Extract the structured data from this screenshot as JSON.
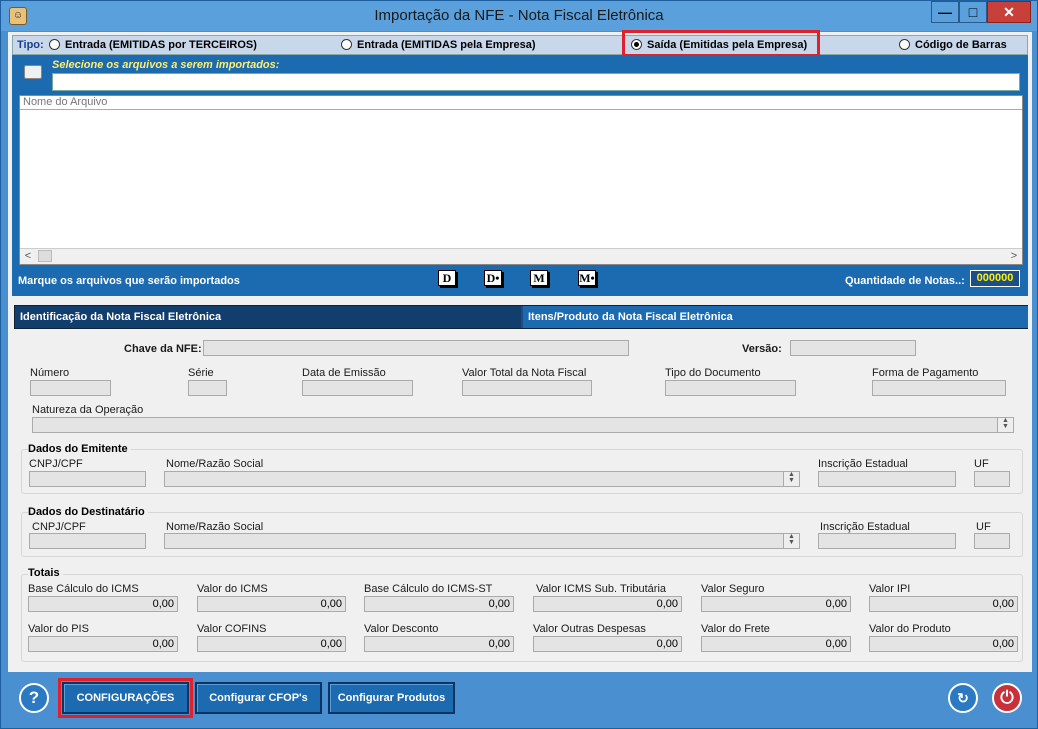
{
  "window": {
    "title": "Importação da NFE - Nota Fiscal Eletrônica",
    "min": "—",
    "max": "□",
    "close": "✕"
  },
  "tipo": {
    "label": "Tipo:",
    "options": [
      {
        "label": "Entrada (EMITIDAS por TERCEIROS)",
        "selected": false
      },
      {
        "label": "Entrada (EMITIDAS pela Empresa)",
        "selected": false
      },
      {
        "label": "Saída (Emitidas pela Empresa)",
        "selected": true
      },
      {
        "label": "Código de Barras",
        "selected": false
      }
    ]
  },
  "files": {
    "select_label": "Selecione os arquivos a serem importados:",
    "path_value": "",
    "column_header": "Nome do Arquivo",
    "scroll_left": "<",
    "scroll_right": ">",
    "mark_label": "Marque os arquivos que serão importados",
    "mark_buttons": [
      "D",
      "D•",
      "M",
      "M•"
    ],
    "quantity_label": "Quantidade de Notas..:",
    "quantity_value": "000000"
  },
  "tabs": [
    "Identificação da Nota Fiscal Eletrônica",
    "Itens/Produto da Nota Fiscal Eletrônica"
  ],
  "ident": {
    "chave_label": "Chave da NFE:",
    "versao_label": "Versão:",
    "numero_label": "Número",
    "serie_label": "Série",
    "data_emissao_label": "Data de Emissão",
    "valor_total_label": "Valor Total da Nota Fiscal",
    "tipo_doc_label": "Tipo do Documento",
    "forma_pag_label": "Forma de Pagamento",
    "natureza_label": "Natureza da Operação"
  },
  "emitente": {
    "title": "Dados do Emitente",
    "cnpj": "CNPJ/CPF",
    "nome": "Nome/Razão Social",
    "ie": "Inscrição Estadual",
    "uf": "UF"
  },
  "destinatario": {
    "title": "Dados do Destinatário",
    "cnpj": "CNPJ/CPF",
    "nome": "Nome/Razão Social",
    "ie": "Inscrição Estadual",
    "uf": "UF"
  },
  "totais": {
    "title": "Totais",
    "items": [
      {
        "label": "Base Cálculo do ICMS",
        "value": "0,00"
      },
      {
        "label": "Valor do ICMS",
        "value": "0,00"
      },
      {
        "label": "Base Cálculo do ICMS-ST",
        "value": "0,00"
      },
      {
        "label": "Valor ICMS Sub. Tributária",
        "value": "0,00"
      },
      {
        "label": "Valor Seguro",
        "value": "0,00"
      },
      {
        "label": "Valor IPI",
        "value": "0,00"
      },
      {
        "label": "Valor do PIS",
        "value": "0,00"
      },
      {
        "label": "Valor COFINS",
        "value": "0,00"
      },
      {
        "label": "Valor Desconto",
        "value": "0,00"
      },
      {
        "label": "Valor Outras Despesas",
        "value": "0,00"
      },
      {
        "label": "Valor do Frete",
        "value": "0,00"
      },
      {
        "label": "Valor do Produto",
        "value": "0,00"
      }
    ]
  },
  "footer": {
    "help": "?",
    "config": "CONFIGURAÇÕES",
    "cfop": "Configurar CFOP's",
    "produtos": "Configurar Produtos",
    "exit": "⏻"
  },
  "colors": {
    "accent": "#1c6ab0",
    "highlight": "#e0202a",
    "quantity": "#ffef00"
  }
}
